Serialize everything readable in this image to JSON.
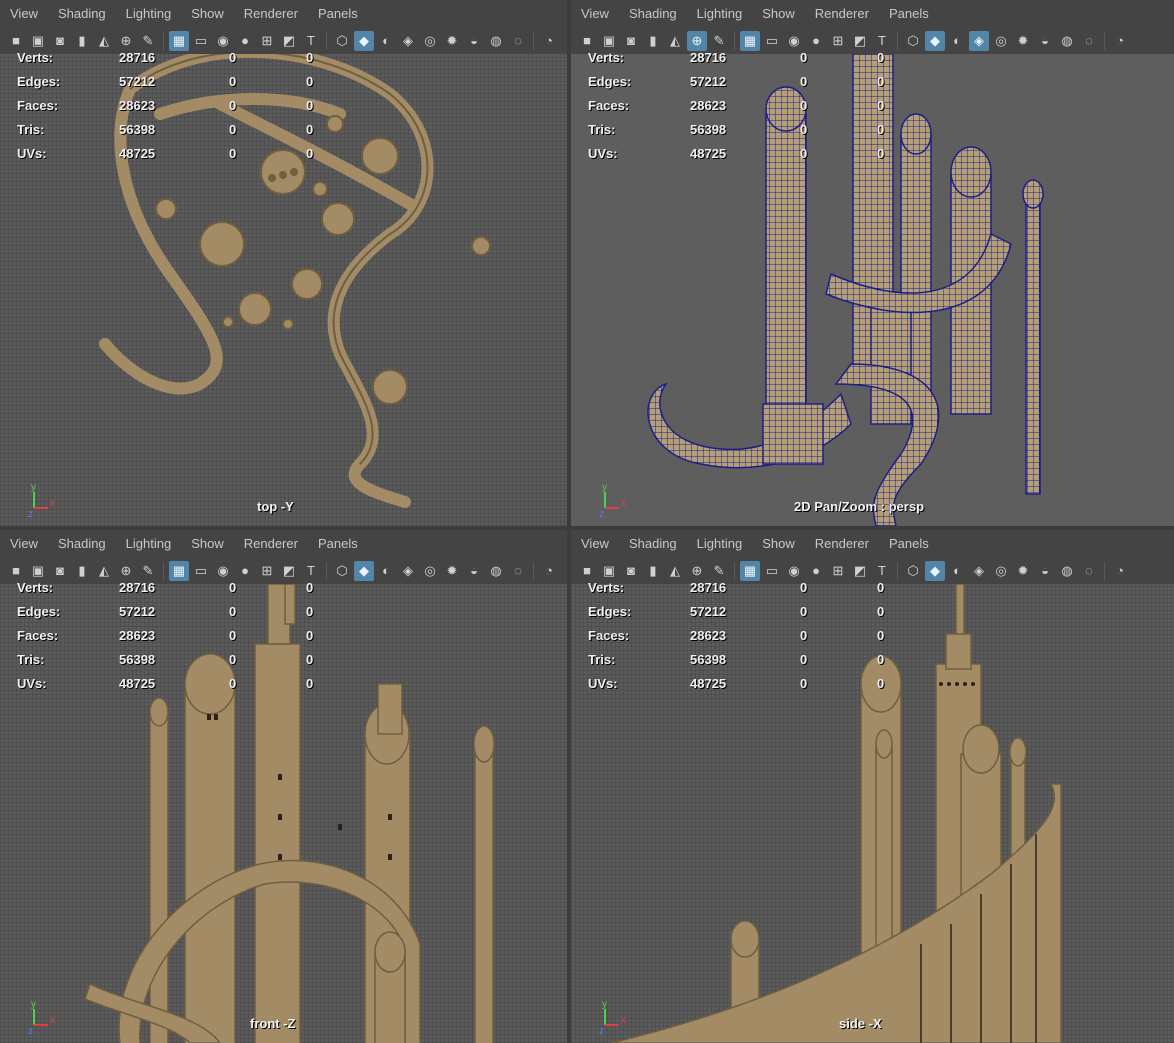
{
  "menu": [
    "View",
    "Shading",
    "Lighting",
    "Show",
    "Renderer",
    "Panels"
  ],
  "stats": {
    "labels": [
      "Verts:",
      "Edges:",
      "Faces:",
      "Tris:",
      "UVs:"
    ],
    "values": [
      "28716",
      "57212",
      "28623",
      "56398",
      "48725"
    ],
    "col2": [
      "0",
      "0",
      "0",
      "0",
      "0"
    ],
    "col3": [
      "0",
      "0",
      "0",
      "0",
      "0"
    ]
  },
  "panels": [
    {
      "caption": "top -Y",
      "axis": [
        "y",
        "z",
        "x"
      ]
    },
    {
      "caption": "2D Pan/Zoom : persp",
      "axis": [
        "y",
        "z",
        "x"
      ]
    },
    {
      "caption": "front -Z",
      "axis": [
        "y",
        "z",
        "x"
      ]
    },
    {
      "caption": "side -X",
      "axis": [
        "y",
        "z",
        "x"
      ]
    }
  ],
  "colors": {
    "model": "#a38c65",
    "model_dark": "#6f5e40",
    "wire": "#1b1f8a",
    "toolbar_active": "#5285a6",
    "viewport_bg": "#5b5b5b"
  },
  "toolbar_icons": [
    "camera-icon",
    "camera-attr-icon",
    "bookmark-camera-icon",
    "bookmark-icon",
    "image-plane-icon",
    "2d-pan-zoom-icon",
    "grease-pencil-icon",
    "grid-icon",
    "film-gate-icon",
    "resolution-gate-icon",
    "gate-mask-icon",
    "field-chart-icon",
    "safe-action-icon",
    "safe-title-icon",
    "wireframe-icon",
    "smooth-shade-icon",
    "default-material-icon",
    "wireframe-on-shaded-icon",
    "xray-icon",
    "use-all-lights-icon",
    "shadows-icon",
    "screen-space-ao-icon",
    "motion-blur-icon",
    "anti-aliasing-icon"
  ]
}
